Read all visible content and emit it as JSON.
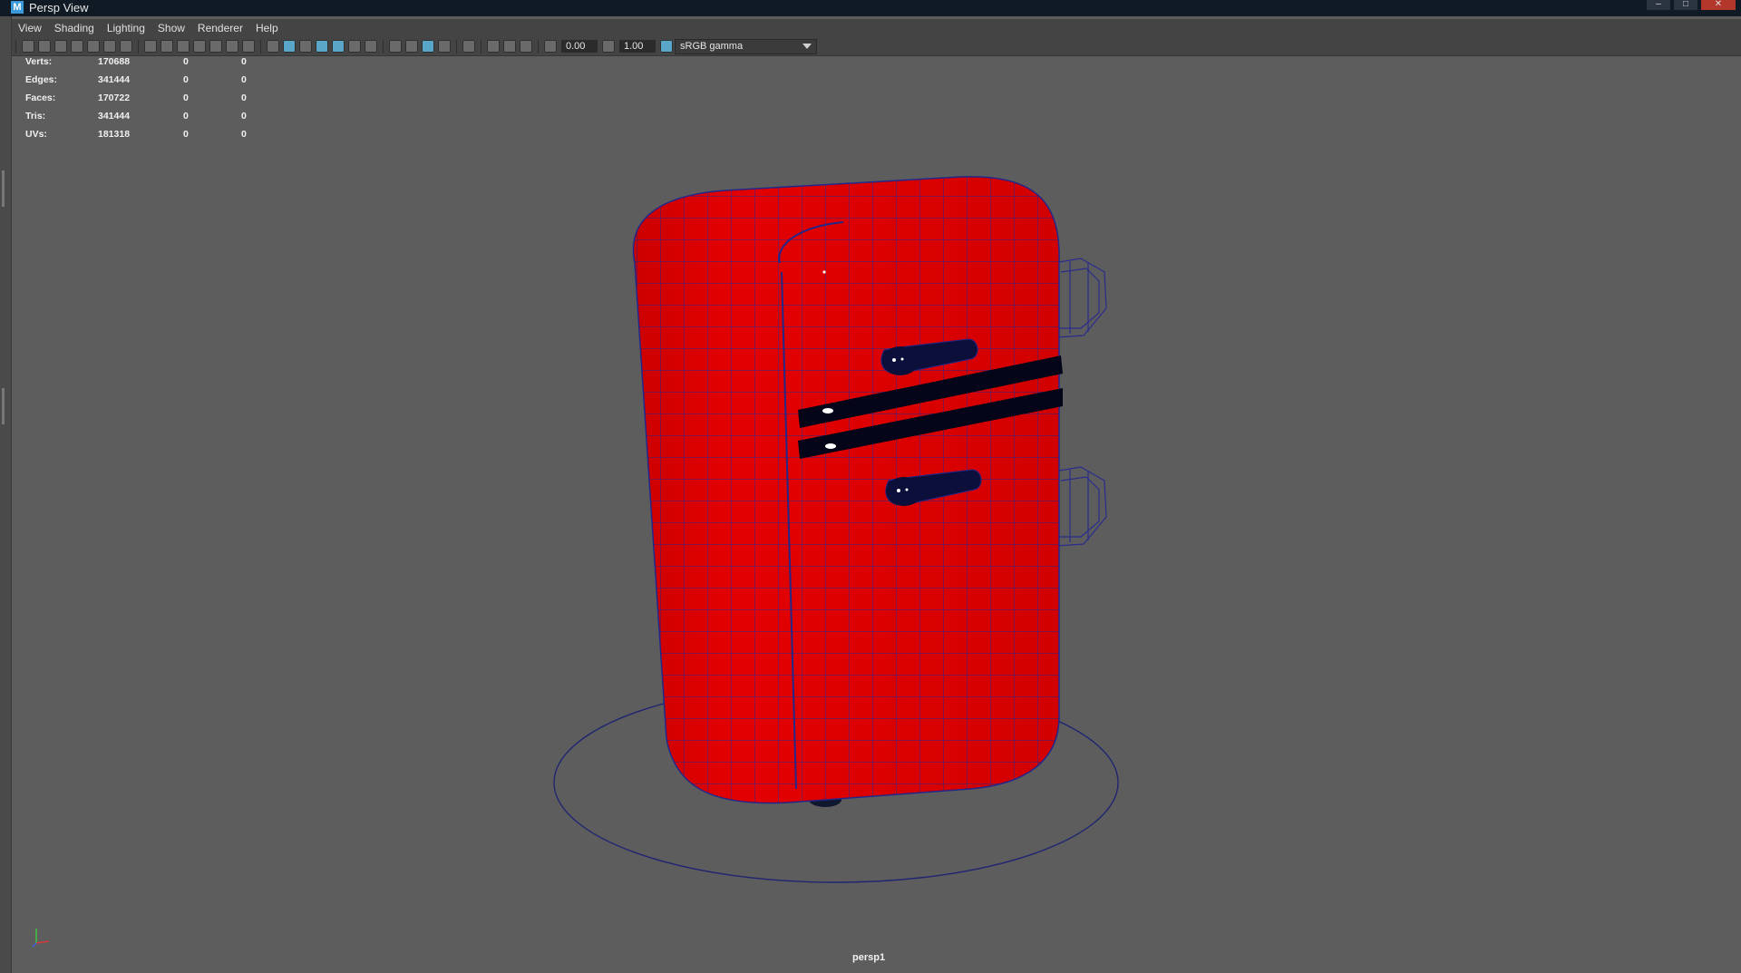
{
  "window": {
    "title": "Persp View",
    "app_icon": "maya-icon"
  },
  "menu": [
    "View",
    "Shading",
    "Lighting",
    "Show",
    "Renderer",
    "Help"
  ],
  "toolbar": {
    "exposure_value": "0.00",
    "gamma_value": "1.00",
    "colorspace": "sRGB gamma"
  },
  "stats": {
    "rows": [
      {
        "label": "Verts:",
        "total": "170688",
        "sel": "0",
        "uvsel": "0"
      },
      {
        "label": "Edges:",
        "total": "341444",
        "sel": "0",
        "uvsel": "0"
      },
      {
        "label": "Faces:",
        "total": "170722",
        "sel": "0",
        "uvsel": "0"
      },
      {
        "label": "Tris:",
        "total": "341444",
        "sel": "0",
        "uvsel": "0"
      },
      {
        "label": "UVs:",
        "total": "181318",
        "sel": "0",
        "uvsel": "0"
      }
    ]
  },
  "viewport": {
    "camera": "persp1",
    "model_color": "#e30000",
    "wire_color": "#202a8a",
    "background": "#5d5d5d"
  }
}
